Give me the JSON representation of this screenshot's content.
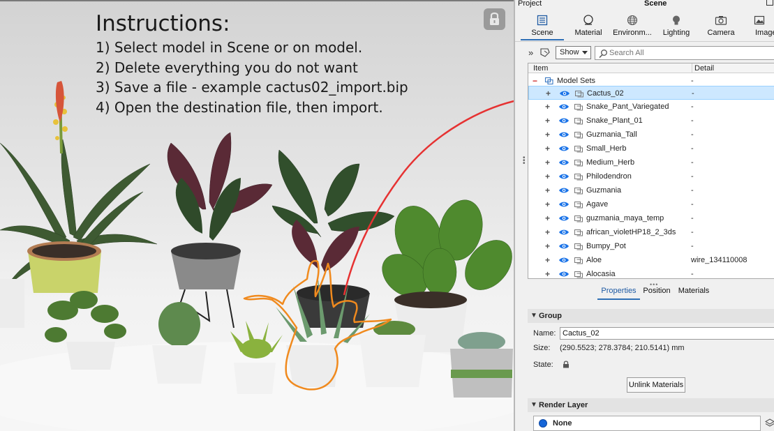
{
  "viewport": {
    "instructions": {
      "title": "Instructions:",
      "steps": [
        "1) Select model in Scene or on model.",
        "2) Delete everything you do not want",
        "3) Save a file - example cactus02_import.bip",
        "4) Open the destination file, then import."
      ]
    },
    "lock_icon": "padlock-icon"
  },
  "panel": {
    "header": {
      "project": "Project",
      "scene": "Scene"
    },
    "tabs": [
      {
        "label": "Scene",
        "icon": "scene-list-icon"
      },
      {
        "label": "Material",
        "icon": "material-sphere-icon"
      },
      {
        "label": "Environm...",
        "icon": "globe-icon"
      },
      {
        "label": "Lighting",
        "icon": "bulb-icon"
      },
      {
        "label": "Camera",
        "icon": "camera-icon"
      },
      {
        "label": "Image",
        "icon": "image-icon"
      }
    ],
    "toolbar": {
      "show_label": "Show",
      "search_placeholder": "Search All"
    },
    "tree": {
      "columns": {
        "item": "Item",
        "detail": "Detail"
      },
      "root": {
        "name": "Model Sets",
        "detail": "-"
      },
      "items": [
        {
          "name": "Cactus_02",
          "detail": "-"
        },
        {
          "name": "Snake_Pant_Variegated",
          "detail": "-"
        },
        {
          "name": "Snake_Plant_01",
          "detail": "-"
        },
        {
          "name": "Guzmania_Tall",
          "detail": "-"
        },
        {
          "name": "Small_Herb",
          "detail": "-"
        },
        {
          "name": "Medium_Herb",
          "detail": "-"
        },
        {
          "name": "Philodendron",
          "detail": "-"
        },
        {
          "name": "Guzmania",
          "detail": "-"
        },
        {
          "name": "Agave",
          "detail": "-"
        },
        {
          "name": "guzmania_maya_temp",
          "detail": "-"
        },
        {
          "name": "african_violetHP18_2_3ds",
          "detail": "-"
        },
        {
          "name": "Bumpy_Pot",
          "detail": "-"
        },
        {
          "name": "Aloe",
          "detail": "wire_134110008"
        },
        {
          "name": "Alocasia",
          "detail": "-"
        }
      ]
    },
    "prop_tabs": [
      "Properties",
      "Position",
      "Materials"
    ],
    "group": {
      "header": "Group",
      "name_label": "Name:",
      "name_value": "Cactus_02",
      "size_label": "Size:",
      "size_value": "(290.5523; 278.3784; 210.5141) mm",
      "state_label": "State:",
      "unlink_label": "Unlink Materials"
    },
    "render_layer": {
      "header": "Render Layer",
      "value": "None"
    }
  },
  "colors": {
    "accent": "#2e6fb5",
    "selection": "#cde8ff",
    "eye": "#1a73e8",
    "annotation_red": "#e63232",
    "annotation_orange": "#f08a1e"
  }
}
